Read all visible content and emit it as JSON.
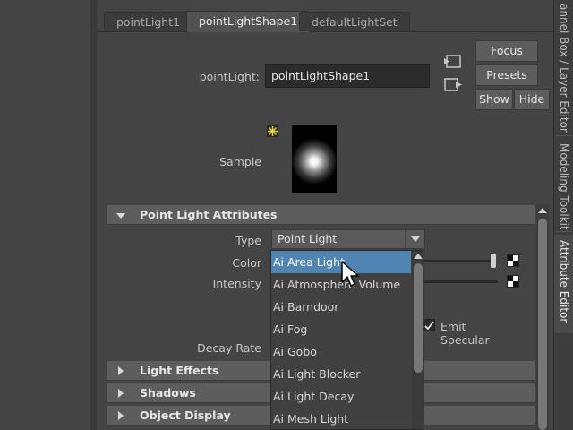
{
  "tabs": [
    {
      "label": "pointLight1",
      "active": false
    },
    {
      "label": "pointLightShape1",
      "active": true
    },
    {
      "label": "defaultLightSet",
      "active": false
    }
  ],
  "header": {
    "node_type_label": "pointLight:",
    "node_name": "pointLightShape1"
  },
  "buttons": {
    "focus": "Focus",
    "presets": "Presets",
    "show": "Show",
    "hide": "Hide"
  },
  "sample": {
    "label": "Sample"
  },
  "sections": [
    {
      "title": "Point Light Attributes",
      "expanded": true
    },
    {
      "title": "Light Effects",
      "expanded": false
    },
    {
      "title": "Shadows",
      "expanded": false
    },
    {
      "title": "Object Display",
      "expanded": false
    }
  ],
  "attributes": {
    "type_label": "Type",
    "type_value": "Point Light",
    "color_label": "Color",
    "intensity_label": "Intensity",
    "emit_specular_label": "Emit Specular",
    "emit_specular_checked": true,
    "decay_rate_label": "Decay Rate"
  },
  "dropdown": {
    "selected_index": 0,
    "items": [
      "Ai Area Light",
      "Ai Atmosphere Volume",
      "Ai Barndoor",
      "Ai Fog",
      "Ai Gobo",
      "Ai Light Blocker",
      "Ai Light Decay",
      "Ai Mesh Light"
    ]
  },
  "right_rail": {
    "tabs": [
      {
        "label": "annel Box / Layer Editor",
        "active": false
      },
      {
        "label": "Modeling Toolkit",
        "active": false
      },
      {
        "label": "Attribute Editor",
        "active": true
      }
    ]
  },
  "colors": {
    "background": "#444444",
    "section_header": "#5d5d5d",
    "selection": "#5084b3",
    "field": "#2b2b2b"
  },
  "icons": [
    "select-node-icon",
    "load-node-icon",
    "light-badge-icon",
    "checkmark-icon",
    "mouse-pointer-icon",
    "chevron-down-icon"
  ]
}
